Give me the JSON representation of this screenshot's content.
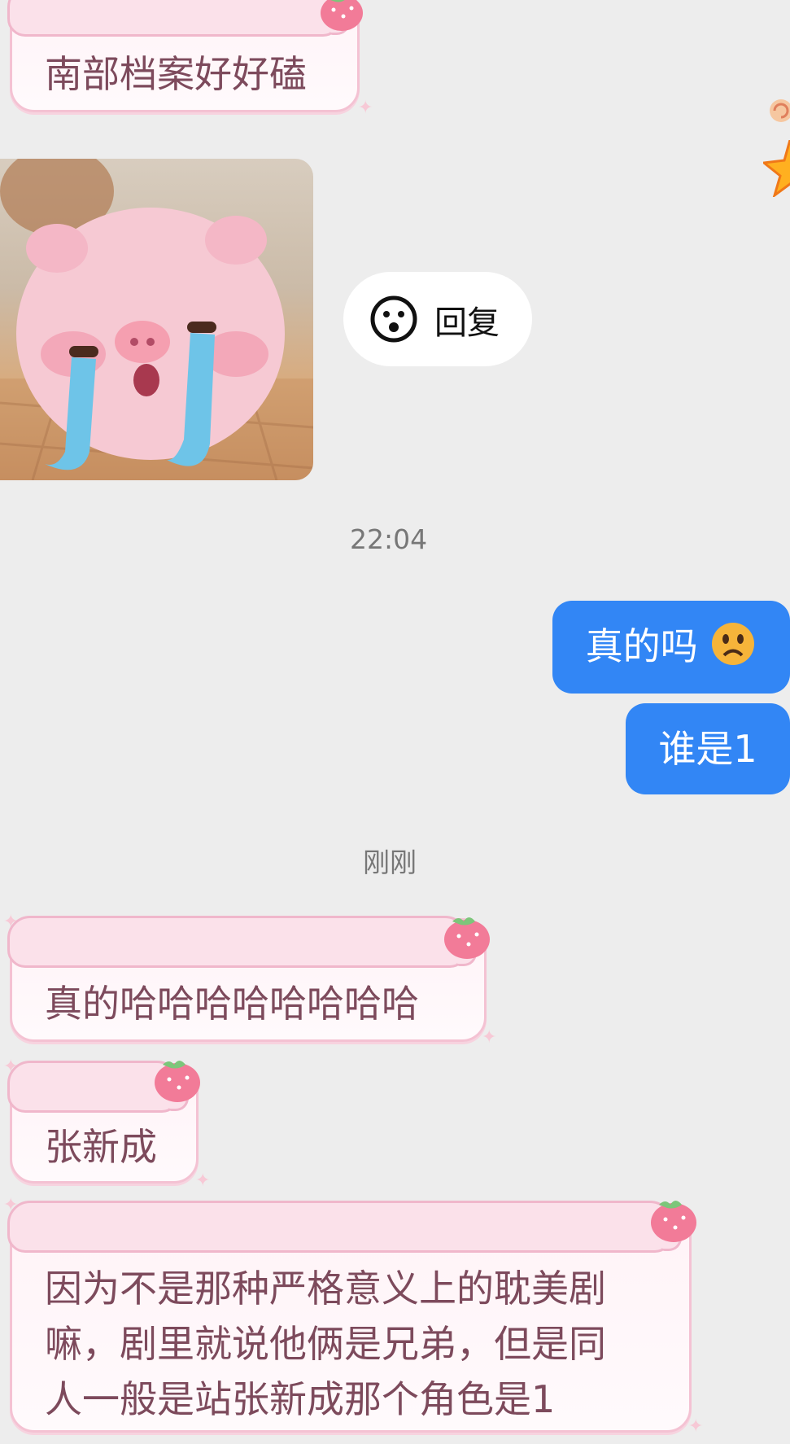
{
  "messages": {
    "m1": "南部档案好好磕",
    "reply_label": "回复",
    "time_1": "22:04",
    "m2": "真的吗",
    "m3": "谁是1",
    "time_2": "刚刚",
    "m4": "真的哈哈哈哈哈哈哈哈",
    "m5": "张新成",
    "m6": "因为不是那种严格意义上的耽美剧\n嘛，剧里就说他俩是兄弟，但是同\n人一般是站张新成那个角色是1"
  },
  "icons": {
    "sticker": "crying-pink-pig-sticker",
    "reply": "smiley-face-icon",
    "emoji": "worried-face-emoji",
    "decoration": "strawberry-icon"
  },
  "colors": {
    "sent_bubble": "#3286f5",
    "received_bubble_border": "#f4c2d3",
    "received_text": "#7d4a5c",
    "background": "#ededed"
  }
}
